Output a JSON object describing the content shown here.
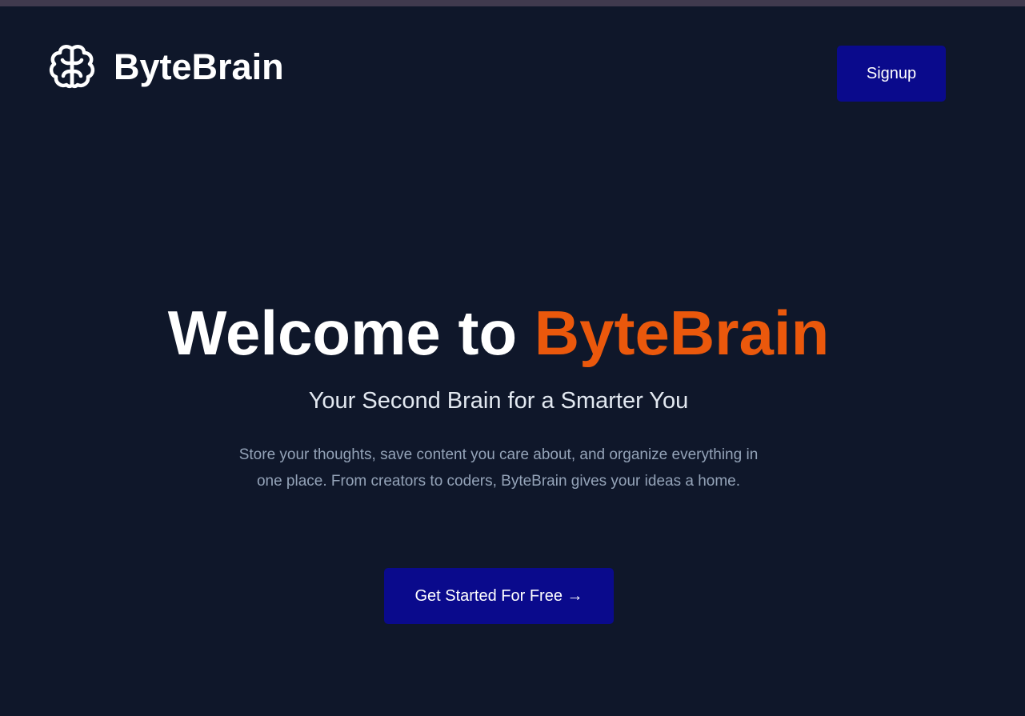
{
  "header": {
    "brand_name": "ByteBrain",
    "logo_icon": "brain-icon",
    "signup_label": "Signup"
  },
  "hero": {
    "title_prefix": "Welcome to ",
    "title_highlight": "ByteBrain",
    "subtitle": "Your Second Brain for a Smarter You",
    "description": "Store your thoughts, save content you care about, and organize everything in one place. From creators to coders, ByteBrain gives your ideas a home.",
    "cta_label": "Get Started For Free →"
  },
  "colors": {
    "background": "#0f172a",
    "accent": "#ea580c",
    "button": "#0a0a8c"
  }
}
